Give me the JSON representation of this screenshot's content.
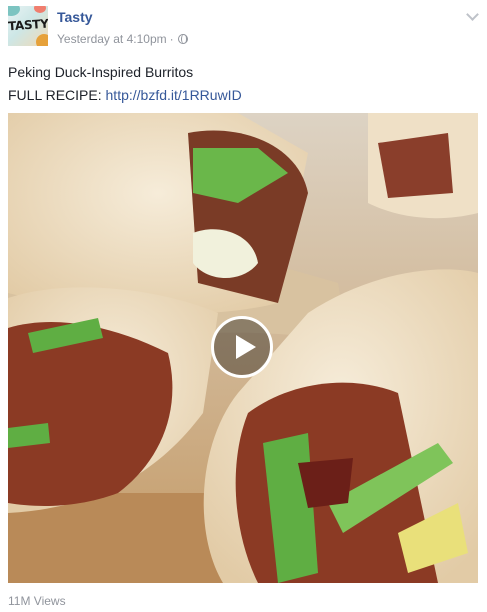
{
  "post": {
    "page_name": "Tasty",
    "avatar_text": "TASTY",
    "timestamp": "Yesterday at 4:10pm",
    "separator": "·",
    "privacy_icon": "globe-icon",
    "menu_icon": "chevron-down-icon",
    "caption_title": "Peking Duck-Inspired Burritos",
    "recipe_prefix": "FULL RECIPE:",
    "recipe_link": "http://bzfd.it/1RRuwID",
    "views": "11M Views"
  },
  "media": {
    "type": "video",
    "play_icon": "play-icon"
  },
  "colors": {
    "link": "#365899",
    "text": "#1d2129",
    "meta": "#90949c"
  }
}
